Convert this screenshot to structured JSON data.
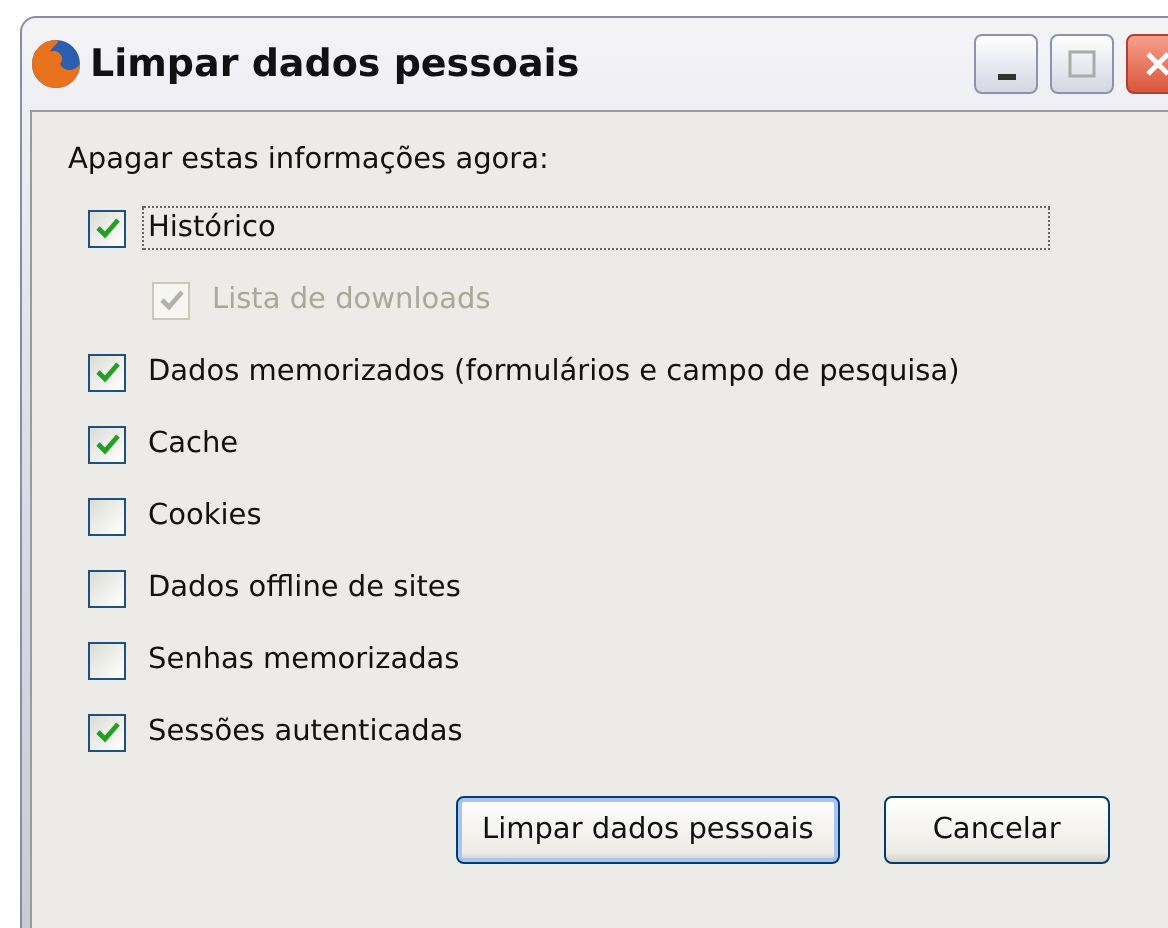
{
  "window": {
    "title": "Limpar dados pessoais"
  },
  "heading": "Apagar estas informações agora:",
  "options": [
    {
      "label": "Histórico",
      "checked": true,
      "disabled": false,
      "focused": true,
      "children": [
        {
          "label": "Lista de downloads",
          "checked": true,
          "disabled": true,
          "focused": false
        }
      ]
    },
    {
      "label": "Dados memorizados (formulários e campo de pesquisa)",
      "checked": true,
      "disabled": false,
      "focused": false
    },
    {
      "label": "Cache",
      "checked": true,
      "disabled": false,
      "focused": false
    },
    {
      "label": "Cookies",
      "checked": false,
      "disabled": false,
      "focused": false
    },
    {
      "label": "Dados offline de sites",
      "checked": false,
      "disabled": false,
      "focused": false
    },
    {
      "label": "Senhas memorizadas",
      "checked": false,
      "disabled": false,
      "focused": false
    },
    {
      "label": "Sessões autenticadas",
      "checked": true,
      "disabled": false,
      "focused": false
    }
  ],
  "buttons": [
    {
      "label": "Limpar dados pessoais",
      "default": true
    },
    {
      "label": "Cancelar",
      "default": false
    }
  ]
}
